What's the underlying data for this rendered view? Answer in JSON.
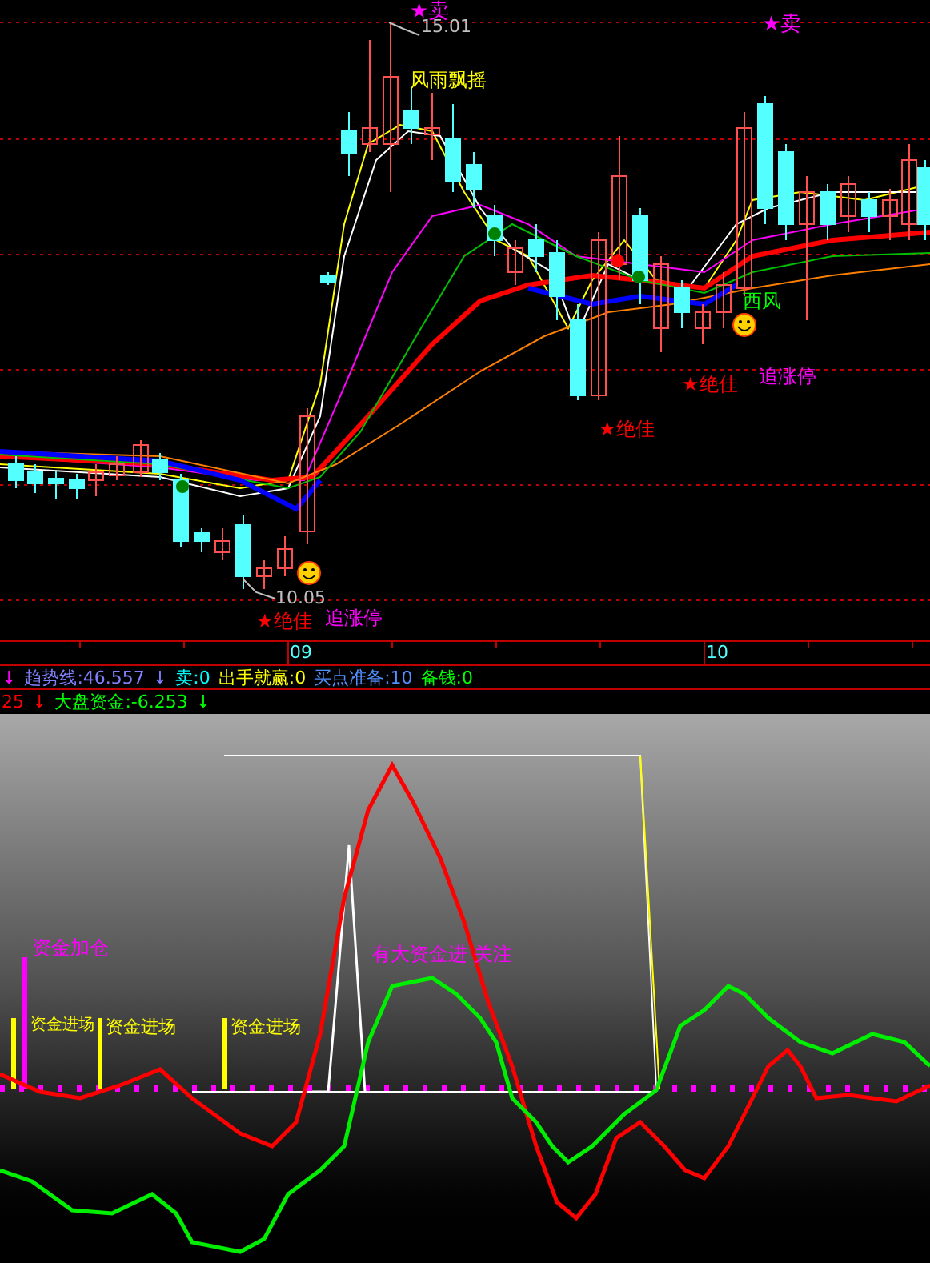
{
  "price_chart": {
    "labels": [
      {
        "text": "★卖",
        "color": "#ff00ff"
      },
      {
        "text": "15.01",
        "color": "#c0c0c0"
      },
      {
        "text": "风雨飘摇",
        "color": "#ffff00"
      },
      {
        "text": "★卖",
        "color": "#ff00ff"
      },
      {
        "text": "西风",
        "color": "#00ff00"
      },
      {
        "text": "追涨停",
        "color": "#ff00ff"
      },
      {
        "text": "★绝佳",
        "color": "#ff0000"
      },
      {
        "text": "★绝佳",
        "color": "#ff0000"
      },
      {
        "text": "10.05",
        "color": "#c0c0c0"
      },
      {
        "text": "★绝佳",
        "color": "#ff0000"
      },
      {
        "text": "追涨停",
        "color": "#ff00ff"
      }
    ]
  },
  "date_axis": {
    "ticks": [
      "09",
      "10"
    ]
  },
  "indicator_rows": [
    [
      {
        "text": "↓",
        "color": "#ff00ff"
      },
      {
        "text": "趋势线:46.557",
        "color": "#8080ff"
      },
      {
        "text": "↓",
        "color": "#8080ff"
      },
      {
        "text": "卖:0",
        "color": "#00ffff"
      },
      {
        "text": "出手就赢:0",
        "color": "#ffff00"
      },
      {
        "text": "买点准备:10",
        "color": "#4f8fff"
      },
      {
        "text": "备钱:0",
        "color": "#00ff00"
      }
    ],
    [
      {
        "text": "25",
        "color": "#ff0000"
      },
      {
        "text": "↓",
        "color": "#ff0000"
      },
      {
        "text": "大盘资金:-6.253",
        "color": "#00ff00"
      },
      {
        "text": "↓",
        "color": "#00ff00"
      }
    ]
  ],
  "fund_chart": {
    "labels": [
      {
        "text": "资金加仓",
        "color": "#ff00ff"
      },
      {
        "text": "资金进场",
        "color": "#ffff00"
      },
      {
        "text": "资金进场",
        "color": "#ffff00"
      },
      {
        "text": "资金进场",
        "color": "#ffff00"
      },
      {
        "text": "有大资金进 关注",
        "color": "#ff00ff"
      }
    ]
  }
}
